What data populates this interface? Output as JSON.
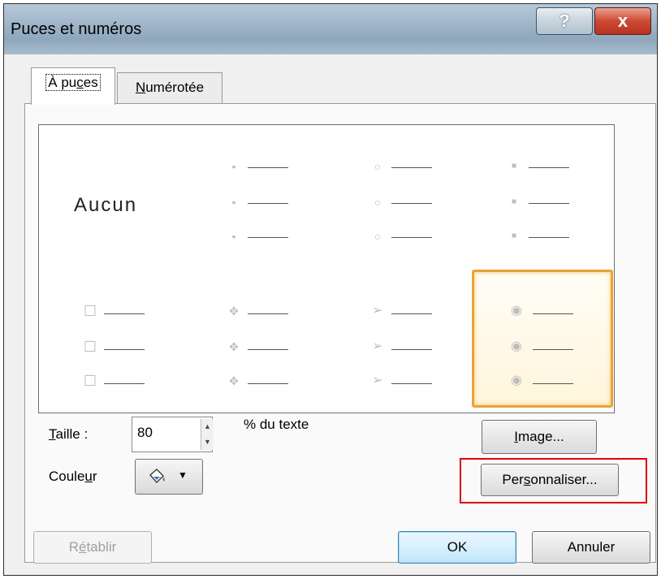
{
  "dialog": {
    "title": "Puces et numéros",
    "help_label": "?",
    "close_label": "x"
  },
  "tabs": [
    {
      "label_pre": "À pu",
      "label_key": "c",
      "label_post": "es"
    },
    {
      "label_key": "N",
      "label_post": "umérotée"
    }
  ],
  "gallery": {
    "none_label": "Aucun",
    "styles": [
      {
        "name": "none",
        "symbol": ""
      },
      {
        "name": "small-dot",
        "symbol": "•"
      },
      {
        "name": "hollow-circle",
        "symbol": "○"
      },
      {
        "name": "small-square",
        "symbol": "■"
      },
      {
        "name": "hollow-square",
        "symbol": "☐"
      },
      {
        "name": "four-diamond",
        "symbol": "✥"
      },
      {
        "name": "arrowhead",
        "symbol": "➢"
      },
      {
        "name": "radio-circle",
        "symbol": "◉",
        "selected": true
      }
    ]
  },
  "size": {
    "label_key": "T",
    "label_post": "aille :",
    "value": "80",
    "suffix": "% du texte"
  },
  "color": {
    "label_pre": "Coule",
    "label_key": "u",
    "label_post": "r",
    "swatch_icon": "paint-bucket-icon",
    "swatch_color": "#4a75b3"
  },
  "buttons": {
    "image": {
      "label_key": "I",
      "label_post": "mage..."
    },
    "customize": {
      "label_pre": "Per",
      "label_key": "s",
      "label_post": "onnaliser..."
    },
    "reset": {
      "label_pre": "R",
      "label_key": "é",
      "label_post": "tablir"
    },
    "ok": "OK",
    "cancel": "Annuler"
  },
  "highlight_color": "#e00000"
}
